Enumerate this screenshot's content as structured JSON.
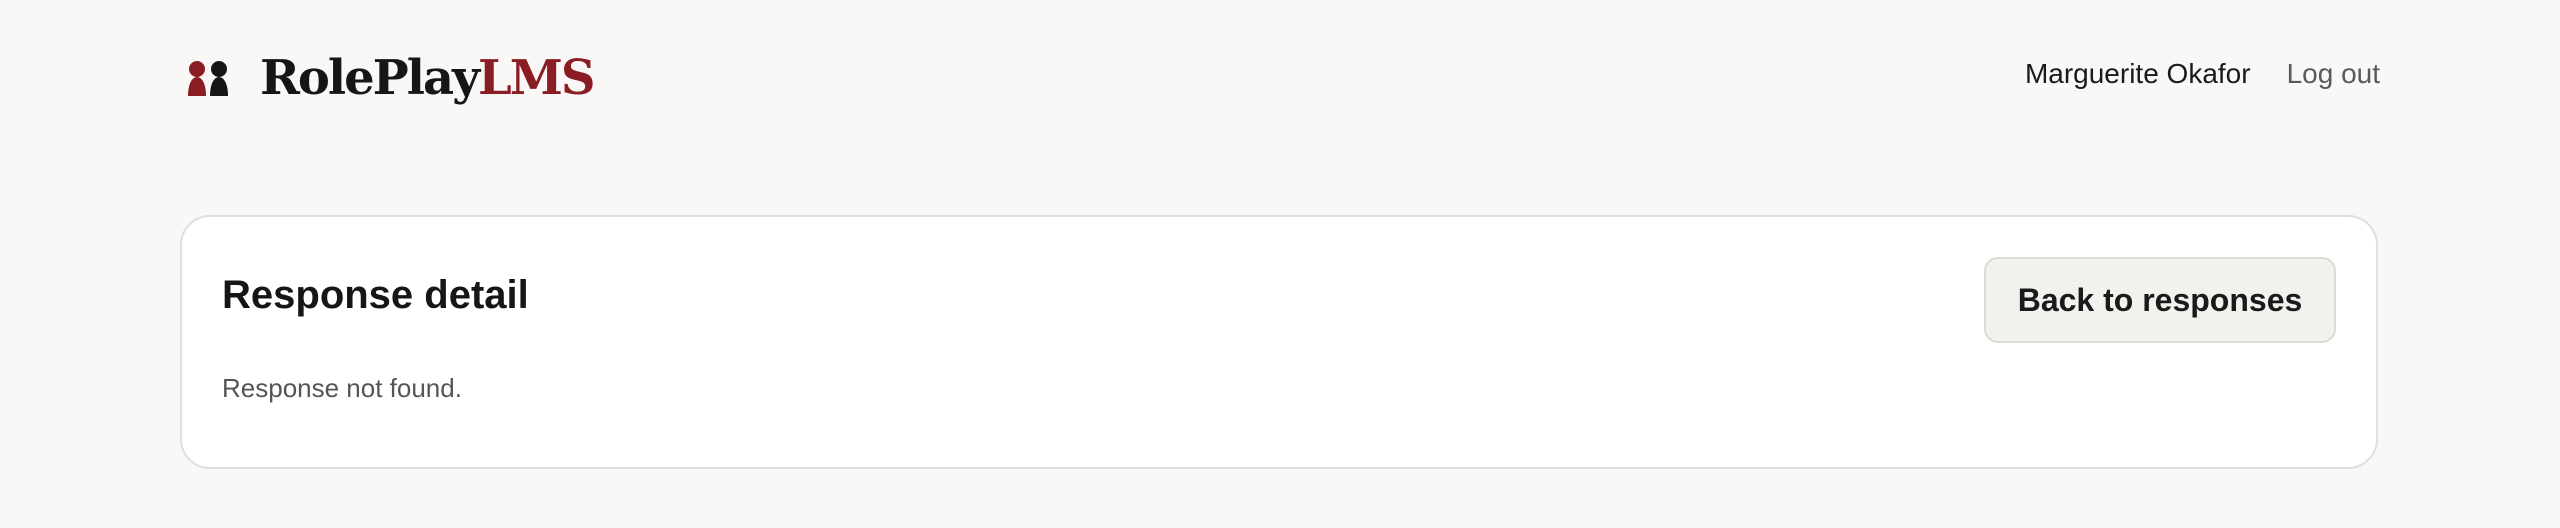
{
  "brand": {
    "name_part1": "RolePlay",
    "name_part2": "LMS",
    "logo_icon": "two-person-silhouettes-icon",
    "colors": {
      "dark": "#161616",
      "accent": "#8a1c24"
    }
  },
  "nav": {
    "user_name": "Marguerite Okafor",
    "logout_label": "Log out"
  },
  "card": {
    "title": "Response detail",
    "back_button_label": "Back to responses",
    "message": "Response not found."
  }
}
